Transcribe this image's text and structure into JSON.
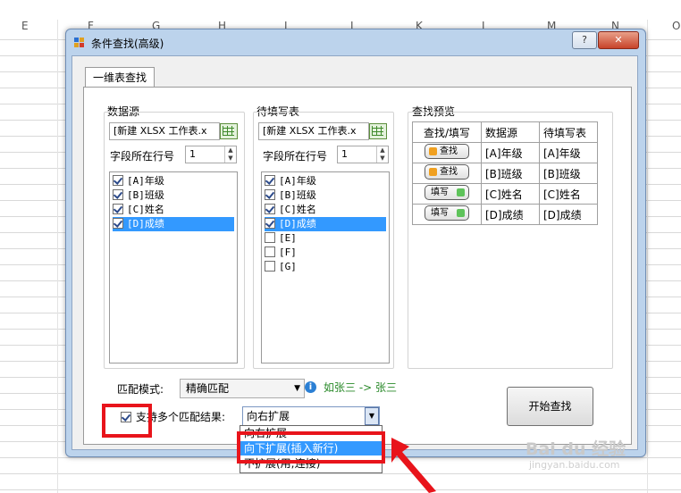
{
  "sheet": {
    "columns": [
      "E",
      "F",
      "G",
      "H",
      "I",
      "J",
      "K",
      "L",
      "M",
      "N",
      "O"
    ]
  },
  "dialog": {
    "title": "条件查找(高级)",
    "help_label": "?",
    "close_label": "✕",
    "tab_label": "一维表查找",
    "source": {
      "group_label": "数据源",
      "combo_value": "[新建 XLSX 工作表.x",
      "row_label": "字段所在行号",
      "row_value": "1",
      "items": [
        {
          "label": "[A]年级",
          "checked": true
        },
        {
          "label": "[B]班级",
          "checked": true
        },
        {
          "label": "[C]姓名",
          "checked": true
        },
        {
          "label": "[D]成绩",
          "checked": true
        }
      ]
    },
    "target": {
      "group_label": "待填写表",
      "combo_value": "[新建 XLSX 工作表.x",
      "row_label": "字段所在行号",
      "row_value": "1",
      "items": [
        {
          "label": "[A]年级",
          "checked": true
        },
        {
          "label": "[B]班级",
          "checked": true
        },
        {
          "label": "[C]姓名",
          "checked": true
        },
        {
          "label": "[D]成绩",
          "checked": true
        },
        {
          "label": "[E]",
          "checked": false
        },
        {
          "label": "[F]",
          "checked": false
        },
        {
          "label": "[G]",
          "checked": false
        }
      ]
    },
    "preview": {
      "group_label": "查找预览",
      "headers": [
        "查找/填写",
        "数据源",
        "待填写表"
      ],
      "rows": [
        {
          "action": "查找",
          "source": "[A]年级",
          "target": "[A]年级"
        },
        {
          "action": "查找",
          "source": "[B]班级",
          "target": "[B]班级"
        },
        {
          "action": "填写",
          "source": "[C]姓名",
          "target": "[C]姓名"
        },
        {
          "action": "填写",
          "source": "[D]成绩",
          "target": "[D]成绩"
        }
      ]
    },
    "match_mode_label": "匹配模式:",
    "match_mode_value": "精确匹配",
    "match_hint": "如张三 -> 张三",
    "multi_label": "支持多个匹配结果:",
    "expand_value": "向右扩展",
    "expand_options": [
      "向右扩展",
      "向下扩展(插入新行)",
      "不扩展(用;连接)"
    ],
    "start_label": "开始查找"
  },
  "watermark": {
    "text": "Bai du 经验",
    "url": "jingyan.baidu.com"
  },
  "colors": {
    "accent": "#3399ff",
    "annotation": "#e8141b",
    "hint": "#2a8a2a"
  }
}
